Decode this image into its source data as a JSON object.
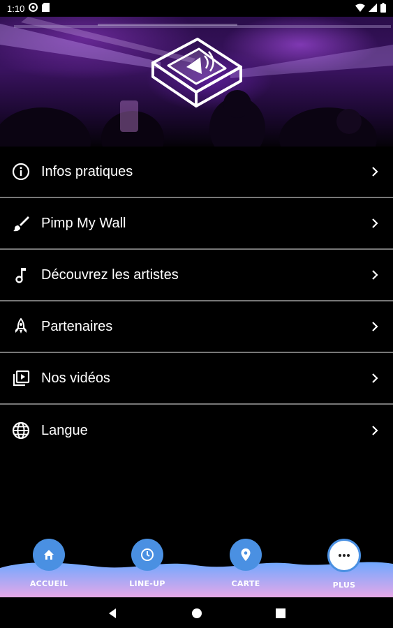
{
  "status_bar": {
    "time": "1:10"
  },
  "menu": {
    "items": [
      {
        "label": "Infos pratiques",
        "icon": "info-icon"
      },
      {
        "label": "Pimp My Wall",
        "icon": "brush-icon"
      },
      {
        "label": "Découvrez les artistes",
        "icon": "music-note-icon"
      },
      {
        "label": "Partenaires",
        "icon": "rocket-icon"
      },
      {
        "label": "Nos vidéos",
        "icon": "video-library-icon"
      },
      {
        "label": "Langue",
        "icon": "globe-icon"
      }
    ]
  },
  "bottom_nav": {
    "items": [
      {
        "label": "ACCUEIL",
        "icon": "home-icon"
      },
      {
        "label": "LINE-UP",
        "icon": "clock-icon"
      },
      {
        "label": "CARTE",
        "icon": "map-pin-icon"
      },
      {
        "label": "PLUS",
        "icon": "more-icon",
        "active": true
      }
    ]
  },
  "colors": {
    "accent": "#4a90e2",
    "wave_top": "#6fa8ff",
    "wave_bottom": "#e6a8e8",
    "divider": "#777777"
  }
}
